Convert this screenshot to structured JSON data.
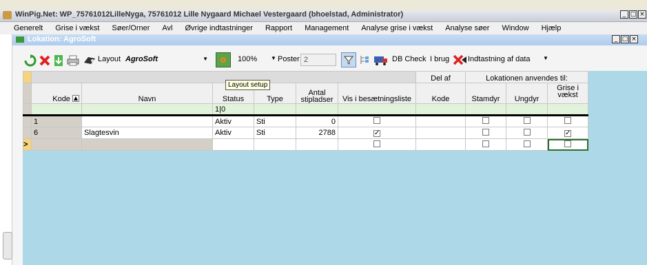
{
  "app": {
    "title": "WinPig.Net: WP_75761012LilleNyga, 75761012 Lille Nygaard Michael Vestergaard (bhoelstad, Administrator)"
  },
  "menu": [
    "Generelt",
    "Grise i vækst",
    "Søer/Orner",
    "Avl",
    "Øvrige indtastninger",
    "Rapport",
    "Management",
    "Analyse grise i vækst",
    "Analyse søer",
    "Window",
    "Hjælp"
  ],
  "child": {
    "title": "Lokation: AgroSoft"
  },
  "toolbar": {
    "layout_label": "Layout",
    "layout_value": "AgroSoft",
    "zoom": "100%",
    "poster_label": "Poster",
    "poster_value": "2",
    "dbcheck": "DB Check",
    "ibrug": "I brug",
    "indtastning": "Indtastning af data",
    "tooltip": "Layout setup"
  },
  "grid": {
    "group_del_af": "Del af",
    "group_lokation": "Lokationen anvendes til:",
    "columns": {
      "kode": "Kode",
      "navn": "Navn",
      "status": "Status",
      "type": "Type",
      "antal": "Antal stipladser",
      "vis": "Vis i besætningsliste",
      "delkode": "Kode",
      "stamdyr": "Stamdyr",
      "ungdyr": "Ungdyr",
      "grise": "Grise i vækst"
    },
    "filter_status": "1|0",
    "rows": [
      {
        "kode": "1",
        "navn": "",
        "status": "Aktiv",
        "type": "Sti",
        "antal": "0",
        "vis": false,
        "stamdyr": false,
        "ungdyr": false,
        "grise": false
      },
      {
        "kode": "6",
        "navn": "Slagtesvin",
        "status": "Aktiv",
        "type": "Sti",
        "antal": "2788",
        "vis": true,
        "stamdyr": false,
        "ungdyr": false,
        "grise": true
      }
    ],
    "new_row_marker": ">"
  }
}
